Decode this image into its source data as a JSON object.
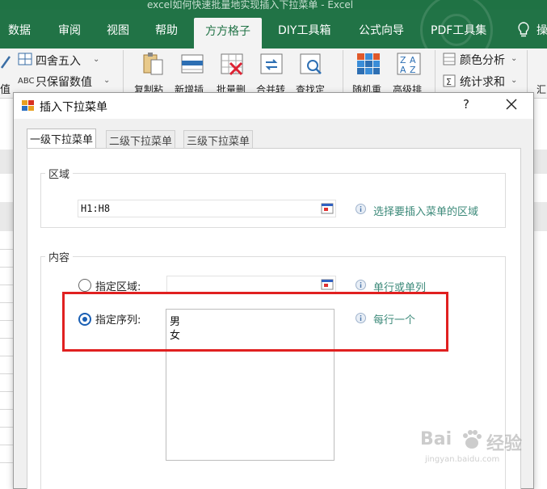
{
  "excel": {
    "window_title": "excel如何快速批量地实现插入下拉菜单 - Excel",
    "tabs": [
      {
        "label": "数据"
      },
      {
        "label": "审阅"
      },
      {
        "label": "视图"
      },
      {
        "label": "帮助"
      },
      {
        "label": "方方格子",
        "active": true
      },
      {
        "label": "DIY工具箱"
      },
      {
        "label": "公式向导"
      },
      {
        "label": "PDF工具集"
      },
      {
        "label": "操"
      }
    ],
    "ribbon": {
      "round_label": "四舍五入",
      "keep_value_label": "只保留数值",
      "keep_value_prefix": "ABC",
      "value_label_cut": "值",
      "buttons": [
        {
          "label": "复制粘"
        },
        {
          "label": "新增插"
        },
        {
          "label": "批量删"
        },
        {
          "label": "合并转"
        },
        {
          "label": "查找定"
        },
        {
          "label": "随机重"
        },
        {
          "label": "高级排"
        }
      ],
      "color_analysis_label": "颜色分析",
      "stat_sum_label": "统计求和",
      "right_cut_label": "汇"
    }
  },
  "dialog": {
    "title": "插入下拉菜单",
    "help_label": "?",
    "tabs": [
      {
        "label": "一级下拉菜单",
        "active": true
      },
      {
        "label": "二级下拉菜单"
      },
      {
        "label": "三级下拉菜单"
      }
    ],
    "region_group": {
      "title": "区域",
      "value": "H1:H8",
      "hint": "选择要插入菜单的区域"
    },
    "content_group": {
      "title": "内容",
      "option_range": {
        "label": "指定区域:",
        "selected": false,
        "value": "",
        "hint": "单行或单列"
      },
      "option_sequence": {
        "label": "指定序列:",
        "selected": true,
        "lines": [
          "男",
          "女"
        ],
        "hint": "每行一个"
      }
    }
  },
  "watermark": {
    "text": "Bai",
    "text2": "经验",
    "sub": "jingyan.baidu.com"
  },
  "colors": {
    "excel_green": "#217346",
    "hint_teal": "#3d8a7a",
    "highlight_red": "#e02020",
    "radio_blue": "#1a5fb4"
  }
}
